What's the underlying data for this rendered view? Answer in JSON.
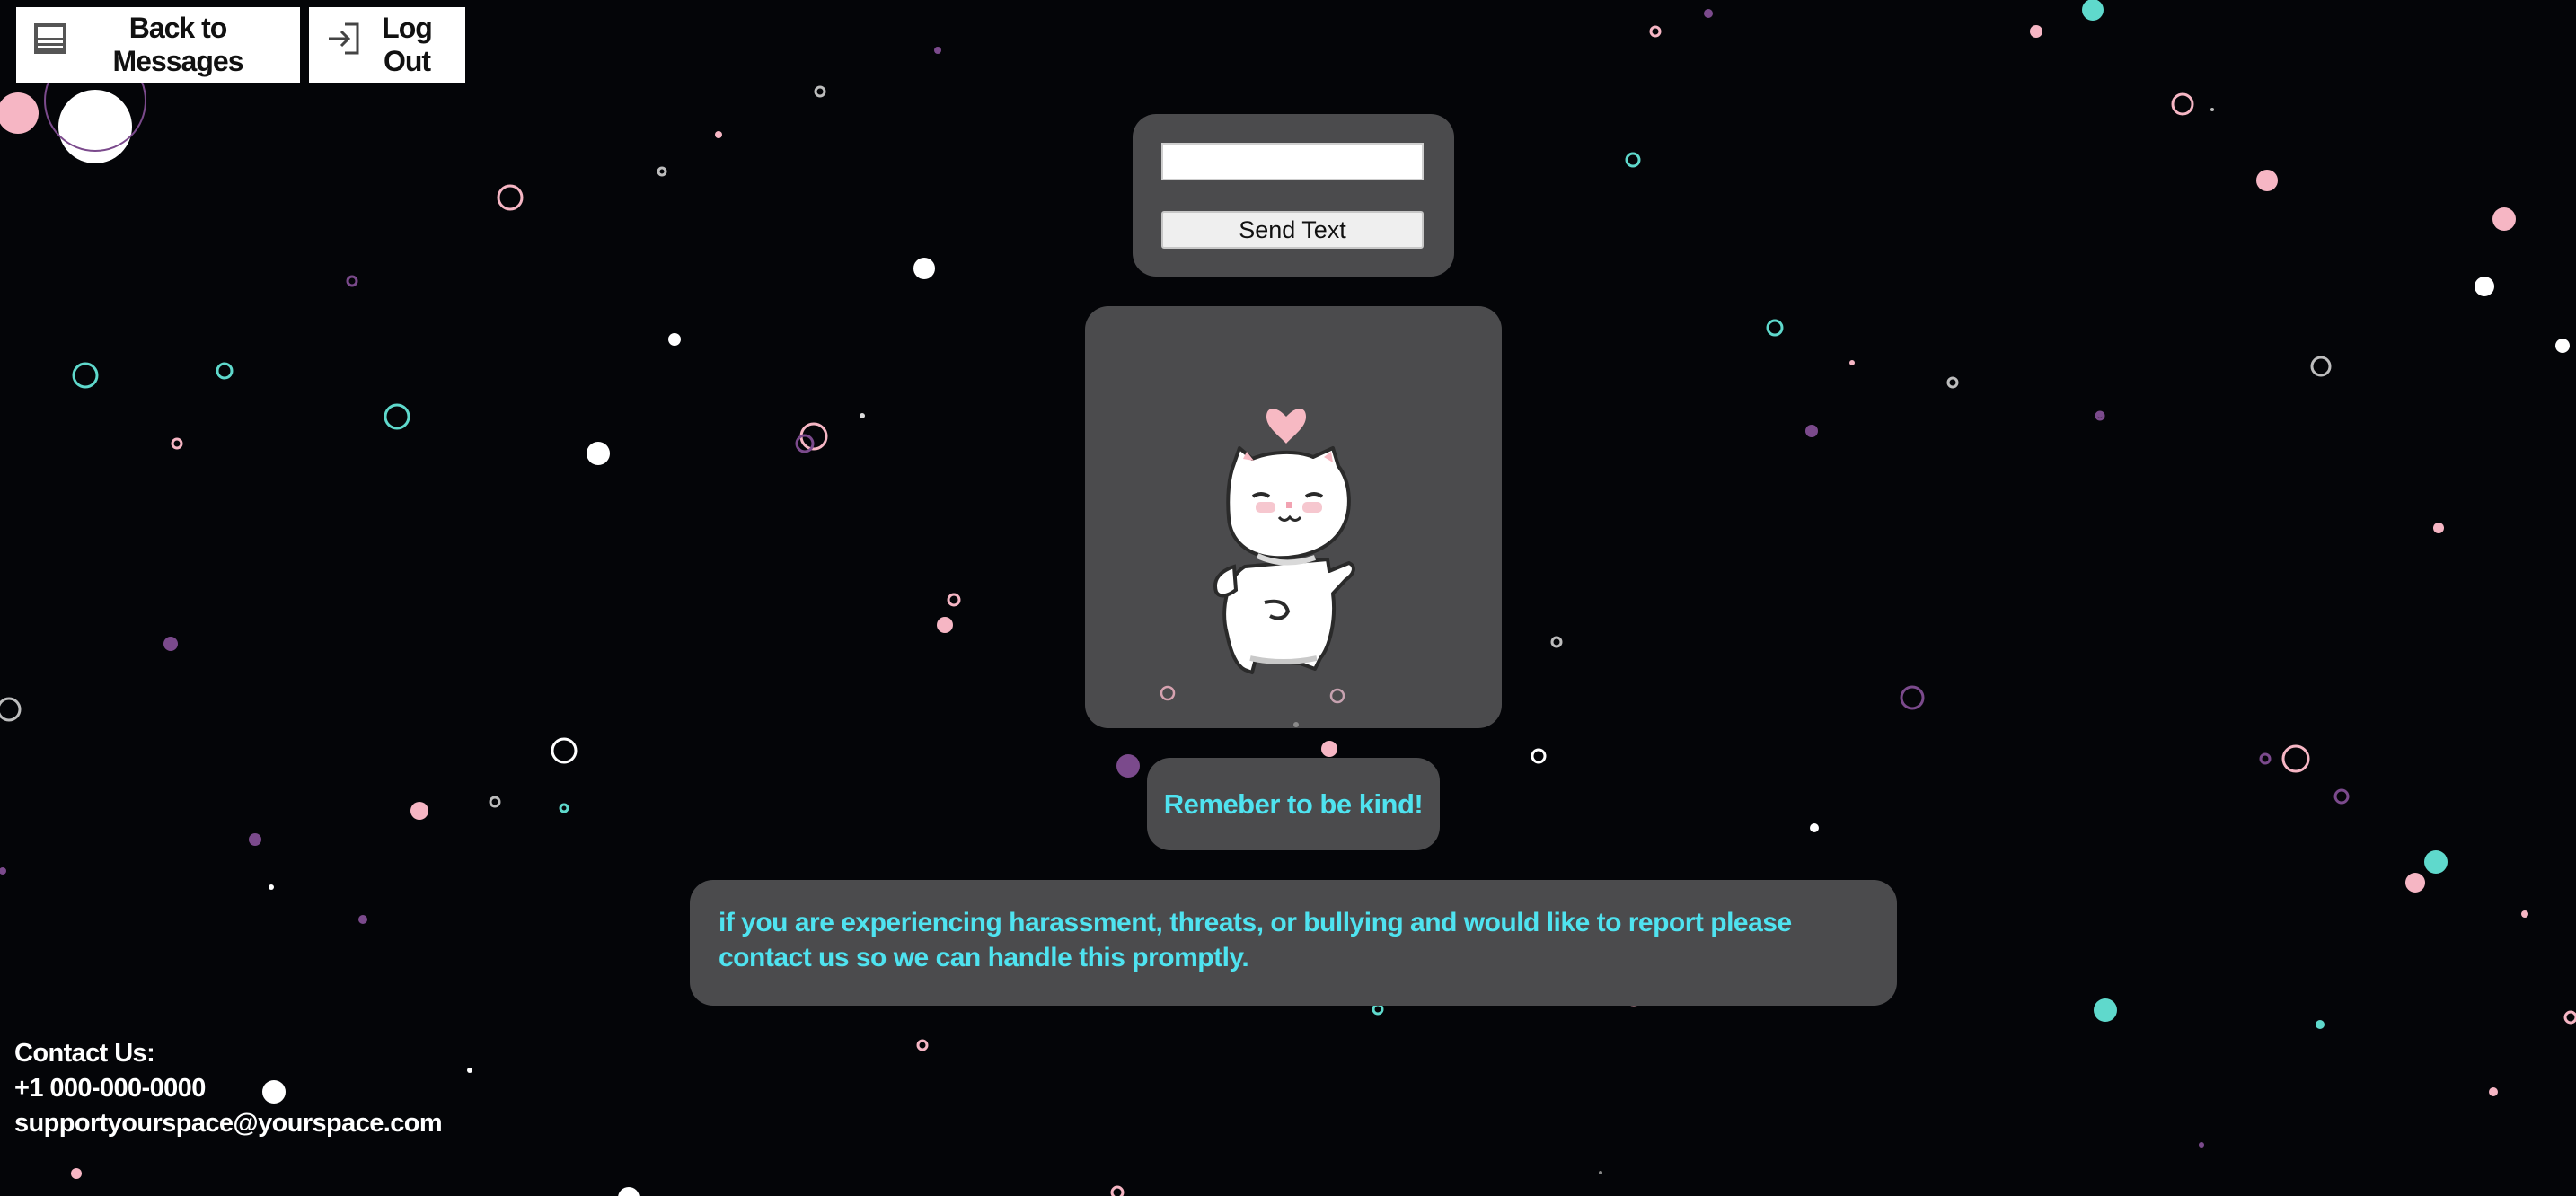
{
  "nav": {
    "back_label": "Back to Messages",
    "logout_label": "Log Out"
  },
  "compose": {
    "input_value": "",
    "send_label": "Send Text"
  },
  "cat_card": {
    "image": "dancing-white-pixel-cat-with-pink-heart"
  },
  "kindness": {
    "message": "Remeber to be kind!"
  },
  "report": {
    "message": "if you are experiencing harassment, threats, or bullying and would like to report please contact us so we can handle this promptly."
  },
  "contact": {
    "heading": "Contact Us:",
    "phone": "+1 000-000-0000",
    "email": "supportyourspace@yourspace.com"
  },
  "colors": {
    "background": "#040508",
    "panel": "#4b4b4d",
    "accent_text": "#4fe3f0",
    "bubble_pink": "#f6b6c4",
    "bubble_teal": "#5fd9cc",
    "bubble_purple": "#7b4a8c",
    "bubble_white": "#ffffff"
  }
}
